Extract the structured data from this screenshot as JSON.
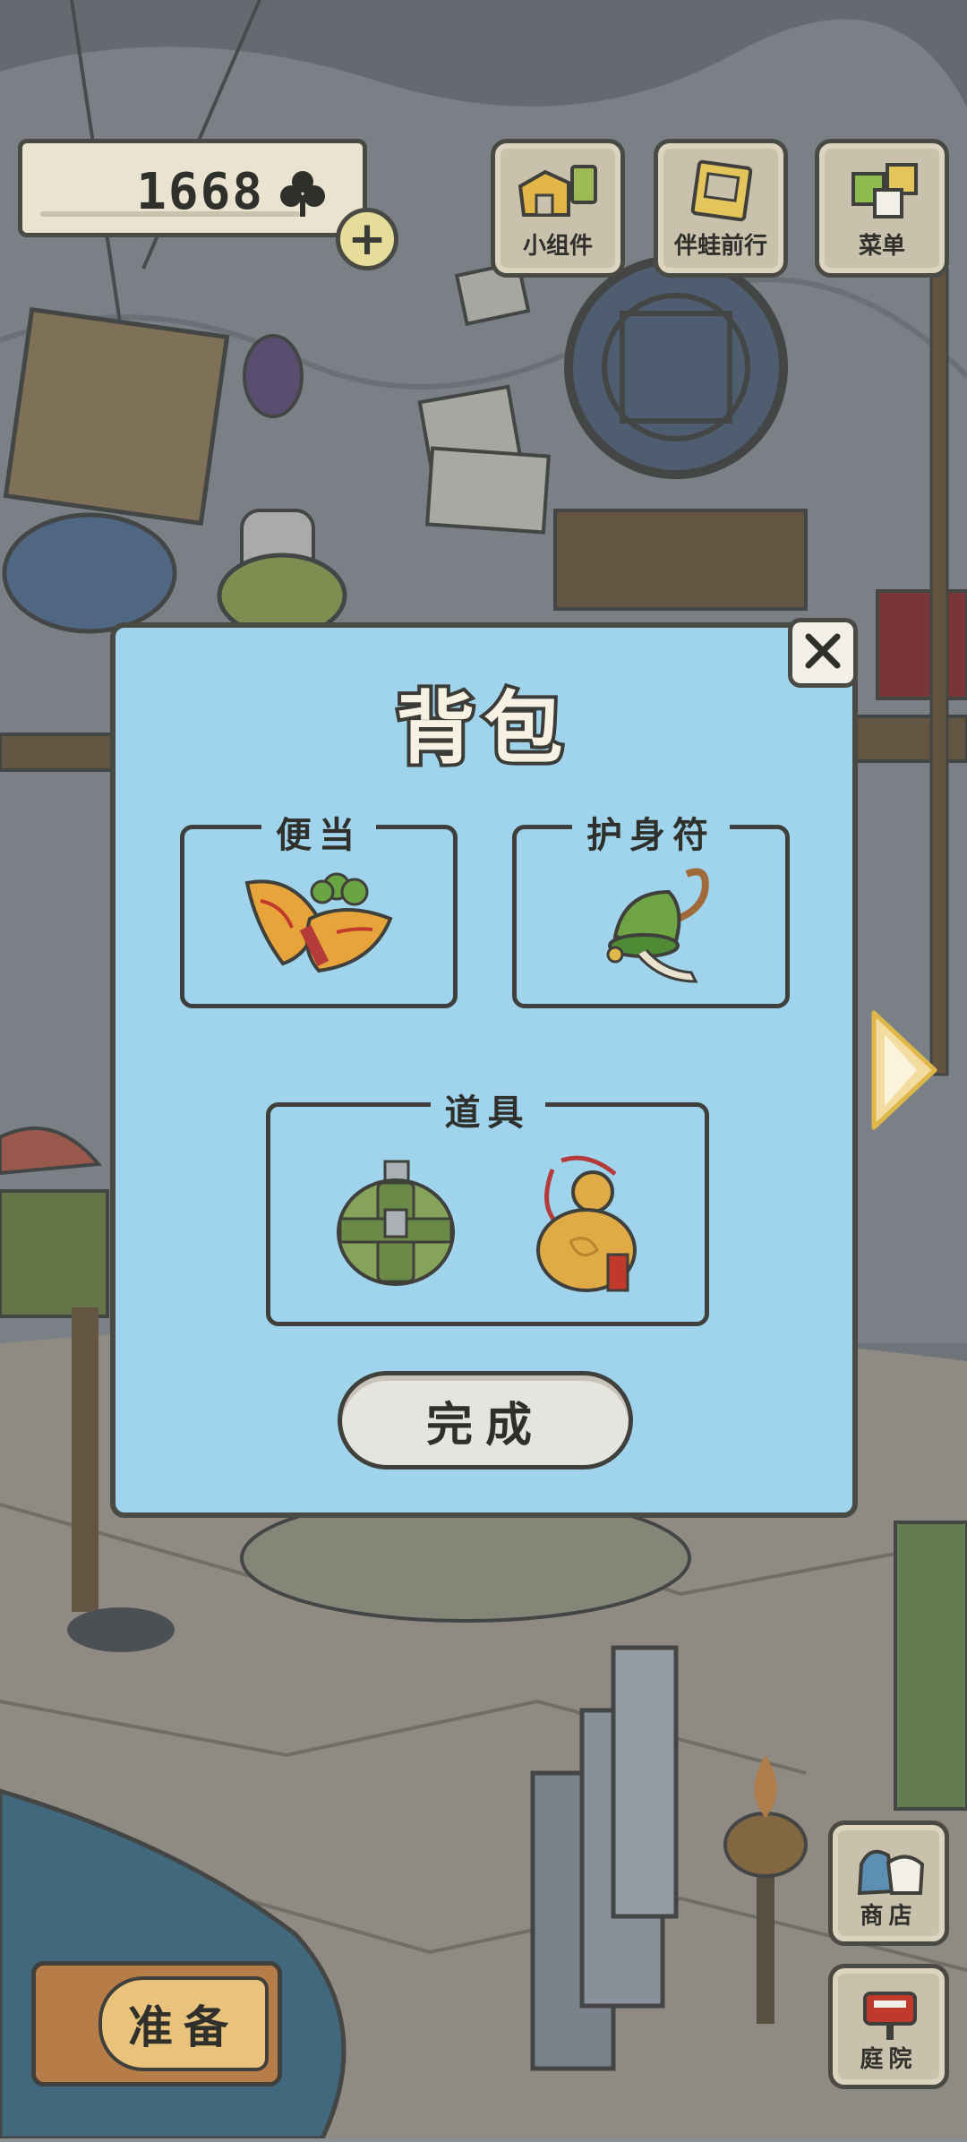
{
  "hud": {
    "clover_count": "1668",
    "add_button": "+",
    "buttons": [
      {
        "label": "小组件",
        "icon": "widget-icon"
      },
      {
        "label": "伴蛙前行",
        "icon": "travel-journal-icon"
      },
      {
        "label": "菜单",
        "icon": "menu-cards-icon"
      }
    ]
  },
  "dialog": {
    "title": "背包",
    "slots": [
      {
        "label": "便当",
        "items": [
          "bento-pie-icon"
        ]
      },
      {
        "label": "护身符",
        "items": [
          "green-bell-charm-icon"
        ]
      },
      {
        "label": "道具",
        "items": [
          "canteen-icon",
          "gourd-icon"
        ]
      }
    ],
    "done_label": "完成"
  },
  "bottom": {
    "prepare_label": "准备",
    "shop_label": "商店",
    "yard_label": "庭院"
  },
  "colors": {
    "dialog_bg": "#a0d4ec",
    "outline": "#4a4a45",
    "hud_bg": "#c9c1ac",
    "arrow": "#f3dca0"
  }
}
